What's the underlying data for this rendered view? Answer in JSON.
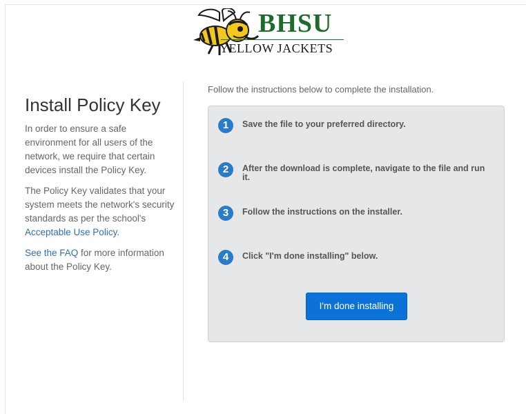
{
  "logo": {
    "name": "BHSU",
    "tagline": "YELLOW JACKETS"
  },
  "sidebar": {
    "title": "Install Policy Key",
    "para1": "In order to ensure a safe environment for all users of the network, we require that certain devices install the Policy Key.",
    "para2_prefix": "The Policy Key validates that your system meets the network's security standards as per the school's ",
    "para2_link": "Acceptable Use Policy",
    "para2_suffix": ".",
    "para3_link": "See the FAQ",
    "para3_suffix": " for more information about the Policy Key."
  },
  "main": {
    "intro": "Follow the instructions below to complete the installation.",
    "steps": [
      {
        "num": "1",
        "text": "Save the file to your preferred directory."
      },
      {
        "num": "2",
        "text": "After the download is complete, navigate to the file and run it."
      },
      {
        "num": "3",
        "text": "Follow the instructions on the installer."
      },
      {
        "num": "4",
        "text": "Click \"I'm done installing\" below."
      }
    ],
    "done_button": "I'm done installing"
  },
  "colors": {
    "accent": "#2a7cc7",
    "button": "#0c72d7",
    "brand_green": "#1e6b2d",
    "brand_yellow": "#f2c81e",
    "panel_bg": "#e6e7e9"
  }
}
